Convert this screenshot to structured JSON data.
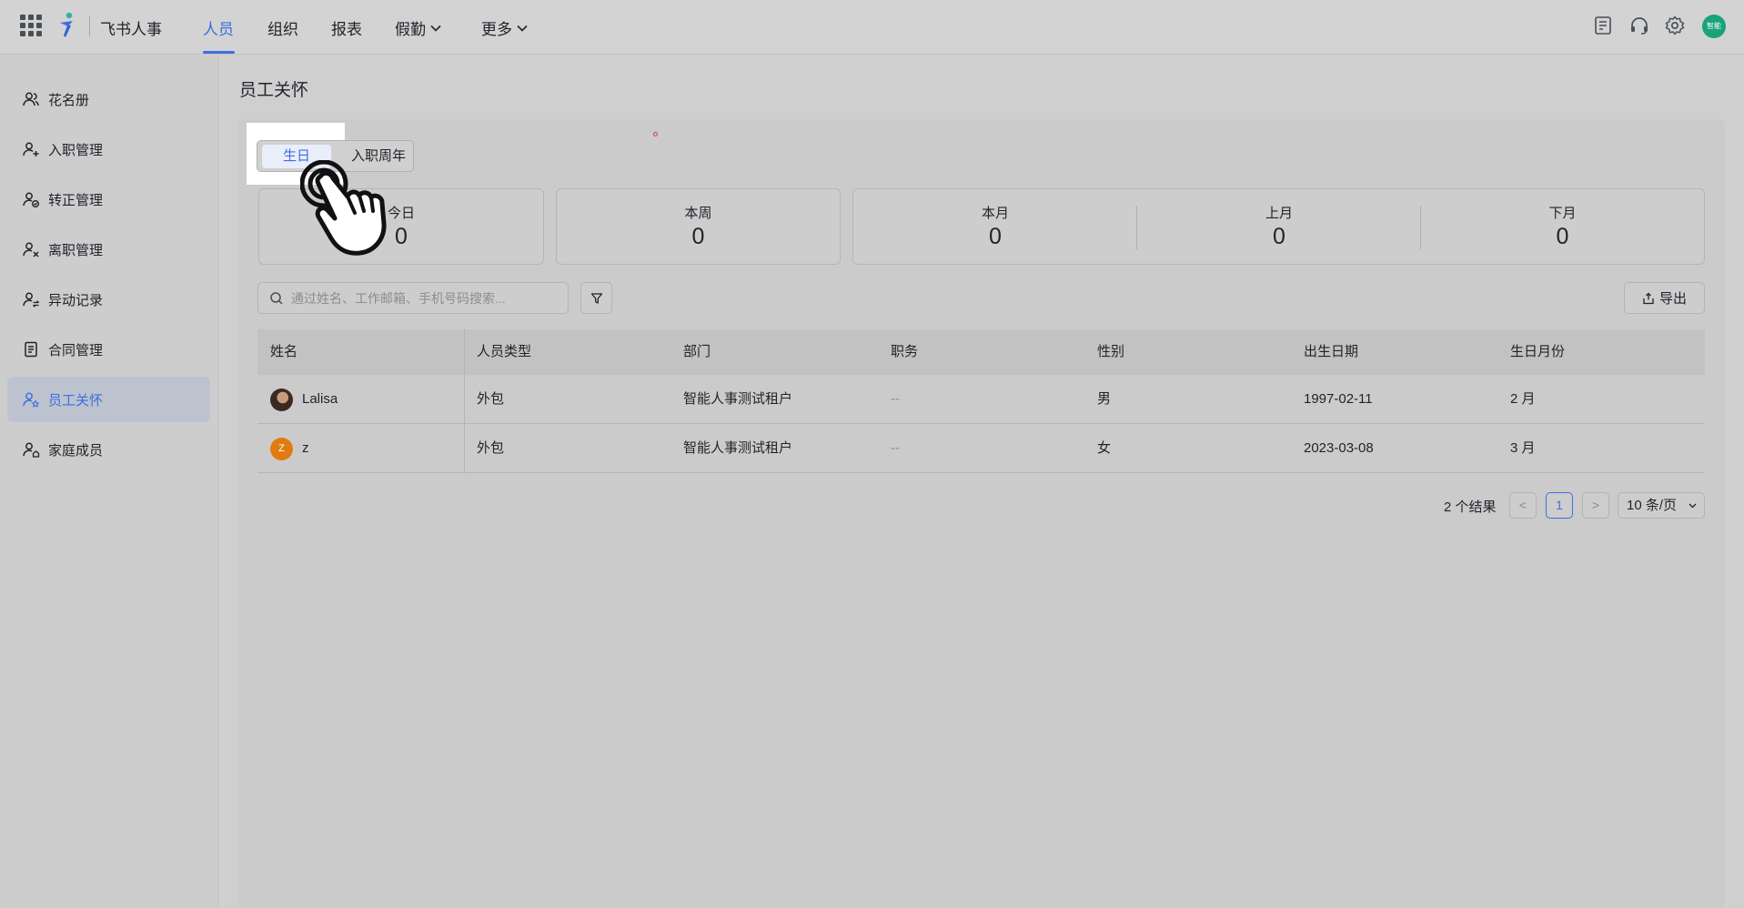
{
  "header": {
    "brand": "飞书人事",
    "nav": [
      {
        "label": "人员",
        "active": true
      },
      {
        "label": "组织"
      },
      {
        "label": "报表"
      },
      {
        "label": "假勤",
        "dropdown": true
      },
      {
        "label": "更多",
        "dropdown": true
      }
    ],
    "tools": [
      "tasks-icon",
      "headset-icon",
      "gear-icon"
    ],
    "avatar_text": "智能"
  },
  "sidebar": {
    "items": [
      {
        "label": "花名册",
        "icon": "people-icon"
      },
      {
        "label": "入职管理",
        "icon": "user-add-icon"
      },
      {
        "label": "转正管理",
        "icon": "user-check-icon"
      },
      {
        "label": "离职管理",
        "icon": "user-remove-icon"
      },
      {
        "label": "异动记录",
        "icon": "user-transfer-icon"
      },
      {
        "label": "合同管理",
        "icon": "document-icon"
      },
      {
        "label": "员工关怀",
        "icon": "user-star-icon",
        "active": true
      },
      {
        "label": "家庭成员",
        "icon": "user-home-icon"
      }
    ]
  },
  "page": {
    "title": "员工关怀",
    "tabs": [
      {
        "label": "生日",
        "active": true
      },
      {
        "label": "入职周年"
      }
    ],
    "stats": {
      "today": {
        "label": "今日",
        "value": "0"
      },
      "week": {
        "label": "本周",
        "value": "0"
      },
      "this_month": {
        "label": "本月",
        "value": "0"
      },
      "last_month": {
        "label": "上月",
        "value": "0"
      },
      "next_month": {
        "label": "下月",
        "value": "0"
      }
    },
    "search_placeholder": "通过姓名、工作邮箱、手机号码搜索...",
    "export_label": "导出"
  },
  "table": {
    "columns": [
      "姓名",
      "人员类型",
      "部门",
      "职务",
      "性别",
      "出生日期",
      "生日月份"
    ],
    "rows": [
      {
        "name": "Lalisa",
        "avatar": "photo",
        "type": "外包",
        "dept": "智能人事测试租户",
        "title": "--",
        "gender": "男",
        "birth": "1997-02-11",
        "month": "2 月"
      },
      {
        "name": "z",
        "avatar": "Z",
        "avatar_color": "#e07b12",
        "type": "外包",
        "dept": "智能人事测试租户",
        "title": "--",
        "gender": "女",
        "birth": "2023-03-08",
        "month": "3 月"
      }
    ]
  },
  "pagination": {
    "total": "2 个结果",
    "prev": "<",
    "current": "1",
    "next": ">",
    "page_size": "10 条/页"
  },
  "colors": {
    "accent": "#3c6fe0",
    "avatar_orange": "#e07b12",
    "brand_green": "#1aa37a"
  }
}
